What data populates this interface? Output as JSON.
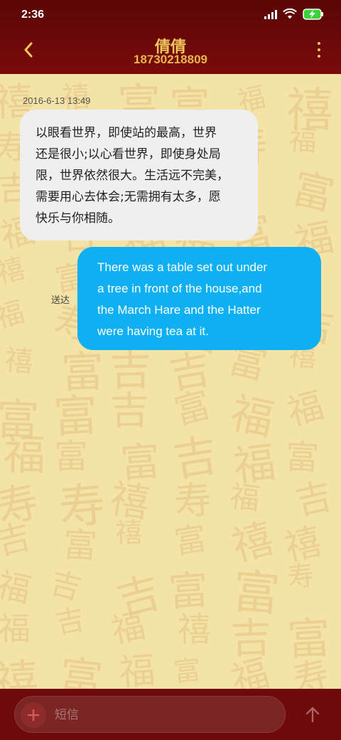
{
  "status": {
    "time": "2:36",
    "signal_icon": "signal-icon",
    "wifi_icon": "wifi-icon",
    "battery_icon": "battery-charging-icon",
    "battery_color": "#3ad23a"
  },
  "header": {
    "title": "倩倩",
    "phone": "18730218809",
    "back_icon": "back-chevron-icon",
    "more_icon": "more-vertical-icon",
    "accent": "#f3c85a",
    "bg": "#6a0909"
  },
  "messages": [
    {
      "timestamp": "2016-6-13 13:49",
      "direction": "incoming",
      "lines": [
        "以眼看世界，即使站的最高，世界",
        "还是很小;以心看世界，即使身处局",
        "限，世界依然很大。生活远不完美，",
        "需要用心去体会;无需拥有太多，愿",
        "快乐与你相随。"
      ]
    },
    {
      "direction": "outgoing",
      "status_label": "送达",
      "lines": [
        "There was a table set out under",
        "a tree in front of the house,and",
        "the March Hare and the Hatter",
        "were having tea at it."
      ],
      "bubble_color": "#0eb0f3"
    }
  ],
  "composer": {
    "placeholder": "短信",
    "add_icon": "plus-icon",
    "send_icon": "send-arrow-up-icon"
  }
}
